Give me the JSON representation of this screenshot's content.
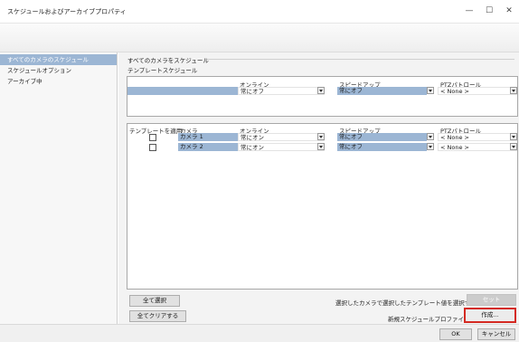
{
  "window": {
    "title": "スケジュールおよびアーカイブプロパティ",
    "minimize": "—",
    "maximize": "☐",
    "close": "✕"
  },
  "sidebar": {
    "items": [
      {
        "label": "すべてのカメラのスケジュール",
        "selected": true
      },
      {
        "label": "スケジュールオプション",
        "selected": false
      },
      {
        "label": "アーカイブ中",
        "selected": false
      }
    ]
  },
  "main": {
    "section_title": "すべてのカメラをスケジュール",
    "template_group": "テンプレートスケジュール",
    "template_table": {
      "headers": [
        "オンライン",
        "スピードアップ",
        "PTZパトロール"
      ],
      "row": {
        "online": "常にオフ",
        "speedup": "常にオフ",
        "ptz": "< None >"
      }
    },
    "camera_table": {
      "headers": [
        "テンプレートを適用",
        "カメラ",
        "オンライン",
        "スピードアップ",
        "PTZパトロール"
      ],
      "rows": [
        {
          "camera": "カメラ 1",
          "online": "常にオン",
          "speedup": "常にオフ",
          "ptz": "< None >"
        },
        {
          "camera": "カメラ 2",
          "online": "常にオン",
          "speedup": "常にオフ",
          "ptz": "< None >"
        }
      ]
    },
    "select_all_button": "全て選択",
    "clear_all_button": "全てクリアする",
    "apply_template_label": "選択したカメラで選択したテンプレート値を選択する:",
    "set_button": "セット",
    "new_profile_label": "新規スケジュールプロファイル:",
    "create_button": "作成..."
  },
  "footer": {
    "ok_button": "OK",
    "cancel_button": "キャンセル"
  },
  "colors": {
    "selection_blue": "#9cb6d4",
    "highlight_red": "#d42a22"
  }
}
